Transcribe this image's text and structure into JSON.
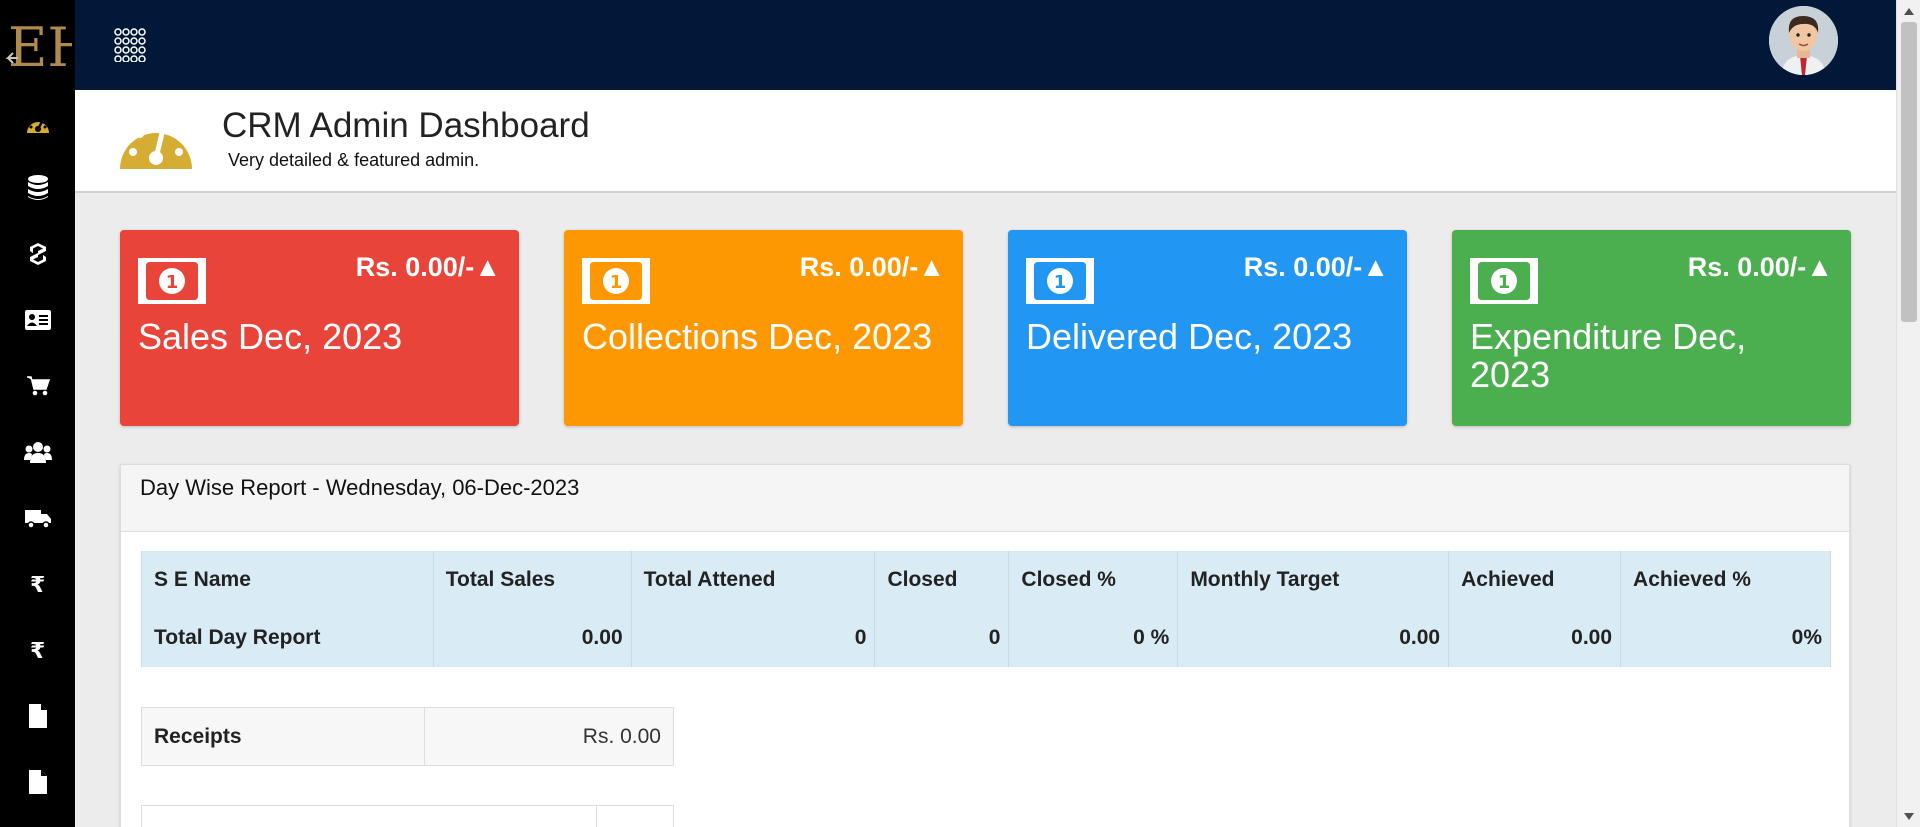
{
  "app": {
    "logo_text": "EH",
    "colors": {
      "sidebar": "#000000",
      "topbar": "#011838",
      "accent": "#d5ad33"
    }
  },
  "sidebar": {
    "items": [
      {
        "icon": "tachometer-icon"
      },
      {
        "icon": "database-icon"
      },
      {
        "icon": "product-icon"
      },
      {
        "icon": "id-card-icon"
      },
      {
        "icon": "cart-icon"
      },
      {
        "icon": "users-icon"
      },
      {
        "icon": "truck-icon"
      },
      {
        "icon": "rupee-icon"
      },
      {
        "icon": "rupee-icon"
      },
      {
        "icon": "file-icon"
      },
      {
        "icon": "file-icon"
      }
    ]
  },
  "header": {
    "title": "CRM Admin Dashboard",
    "subtitle": "Very detailed & featured admin."
  },
  "cards": [
    {
      "amount": "Rs. 0.00/-▲",
      "label": "Sales Dec, 2023",
      "color": "#e8443a"
    },
    {
      "amount": "Rs. 0.00/-▲",
      "label": "Collections Dec, 2023",
      "color": "#fe9802"
    },
    {
      "amount": "Rs. 0.00/-▲",
      "label": "Delivered Dec, 2023",
      "color": "#2196f3"
    },
    {
      "amount": "Rs. 0.00/-▲",
      "label": "Expenditure Dec, 2023",
      "color": "#4caf4f"
    }
  ],
  "report": {
    "title": "Day Wise Report - Wednesday, 06-Dec-2023",
    "columns": [
      "S E Name",
      "Total Sales",
      "Total Attened",
      "Closed",
      "Closed %",
      "Monthly Target",
      "Achieved",
      "Achieved %"
    ],
    "row": [
      "Total Day Report",
      "0.00",
      "0",
      "0",
      "0 %",
      "0.00",
      "0.00",
      "0%"
    ]
  },
  "receipts": {
    "label": "Receipts",
    "value": "Rs. 0.00"
  }
}
